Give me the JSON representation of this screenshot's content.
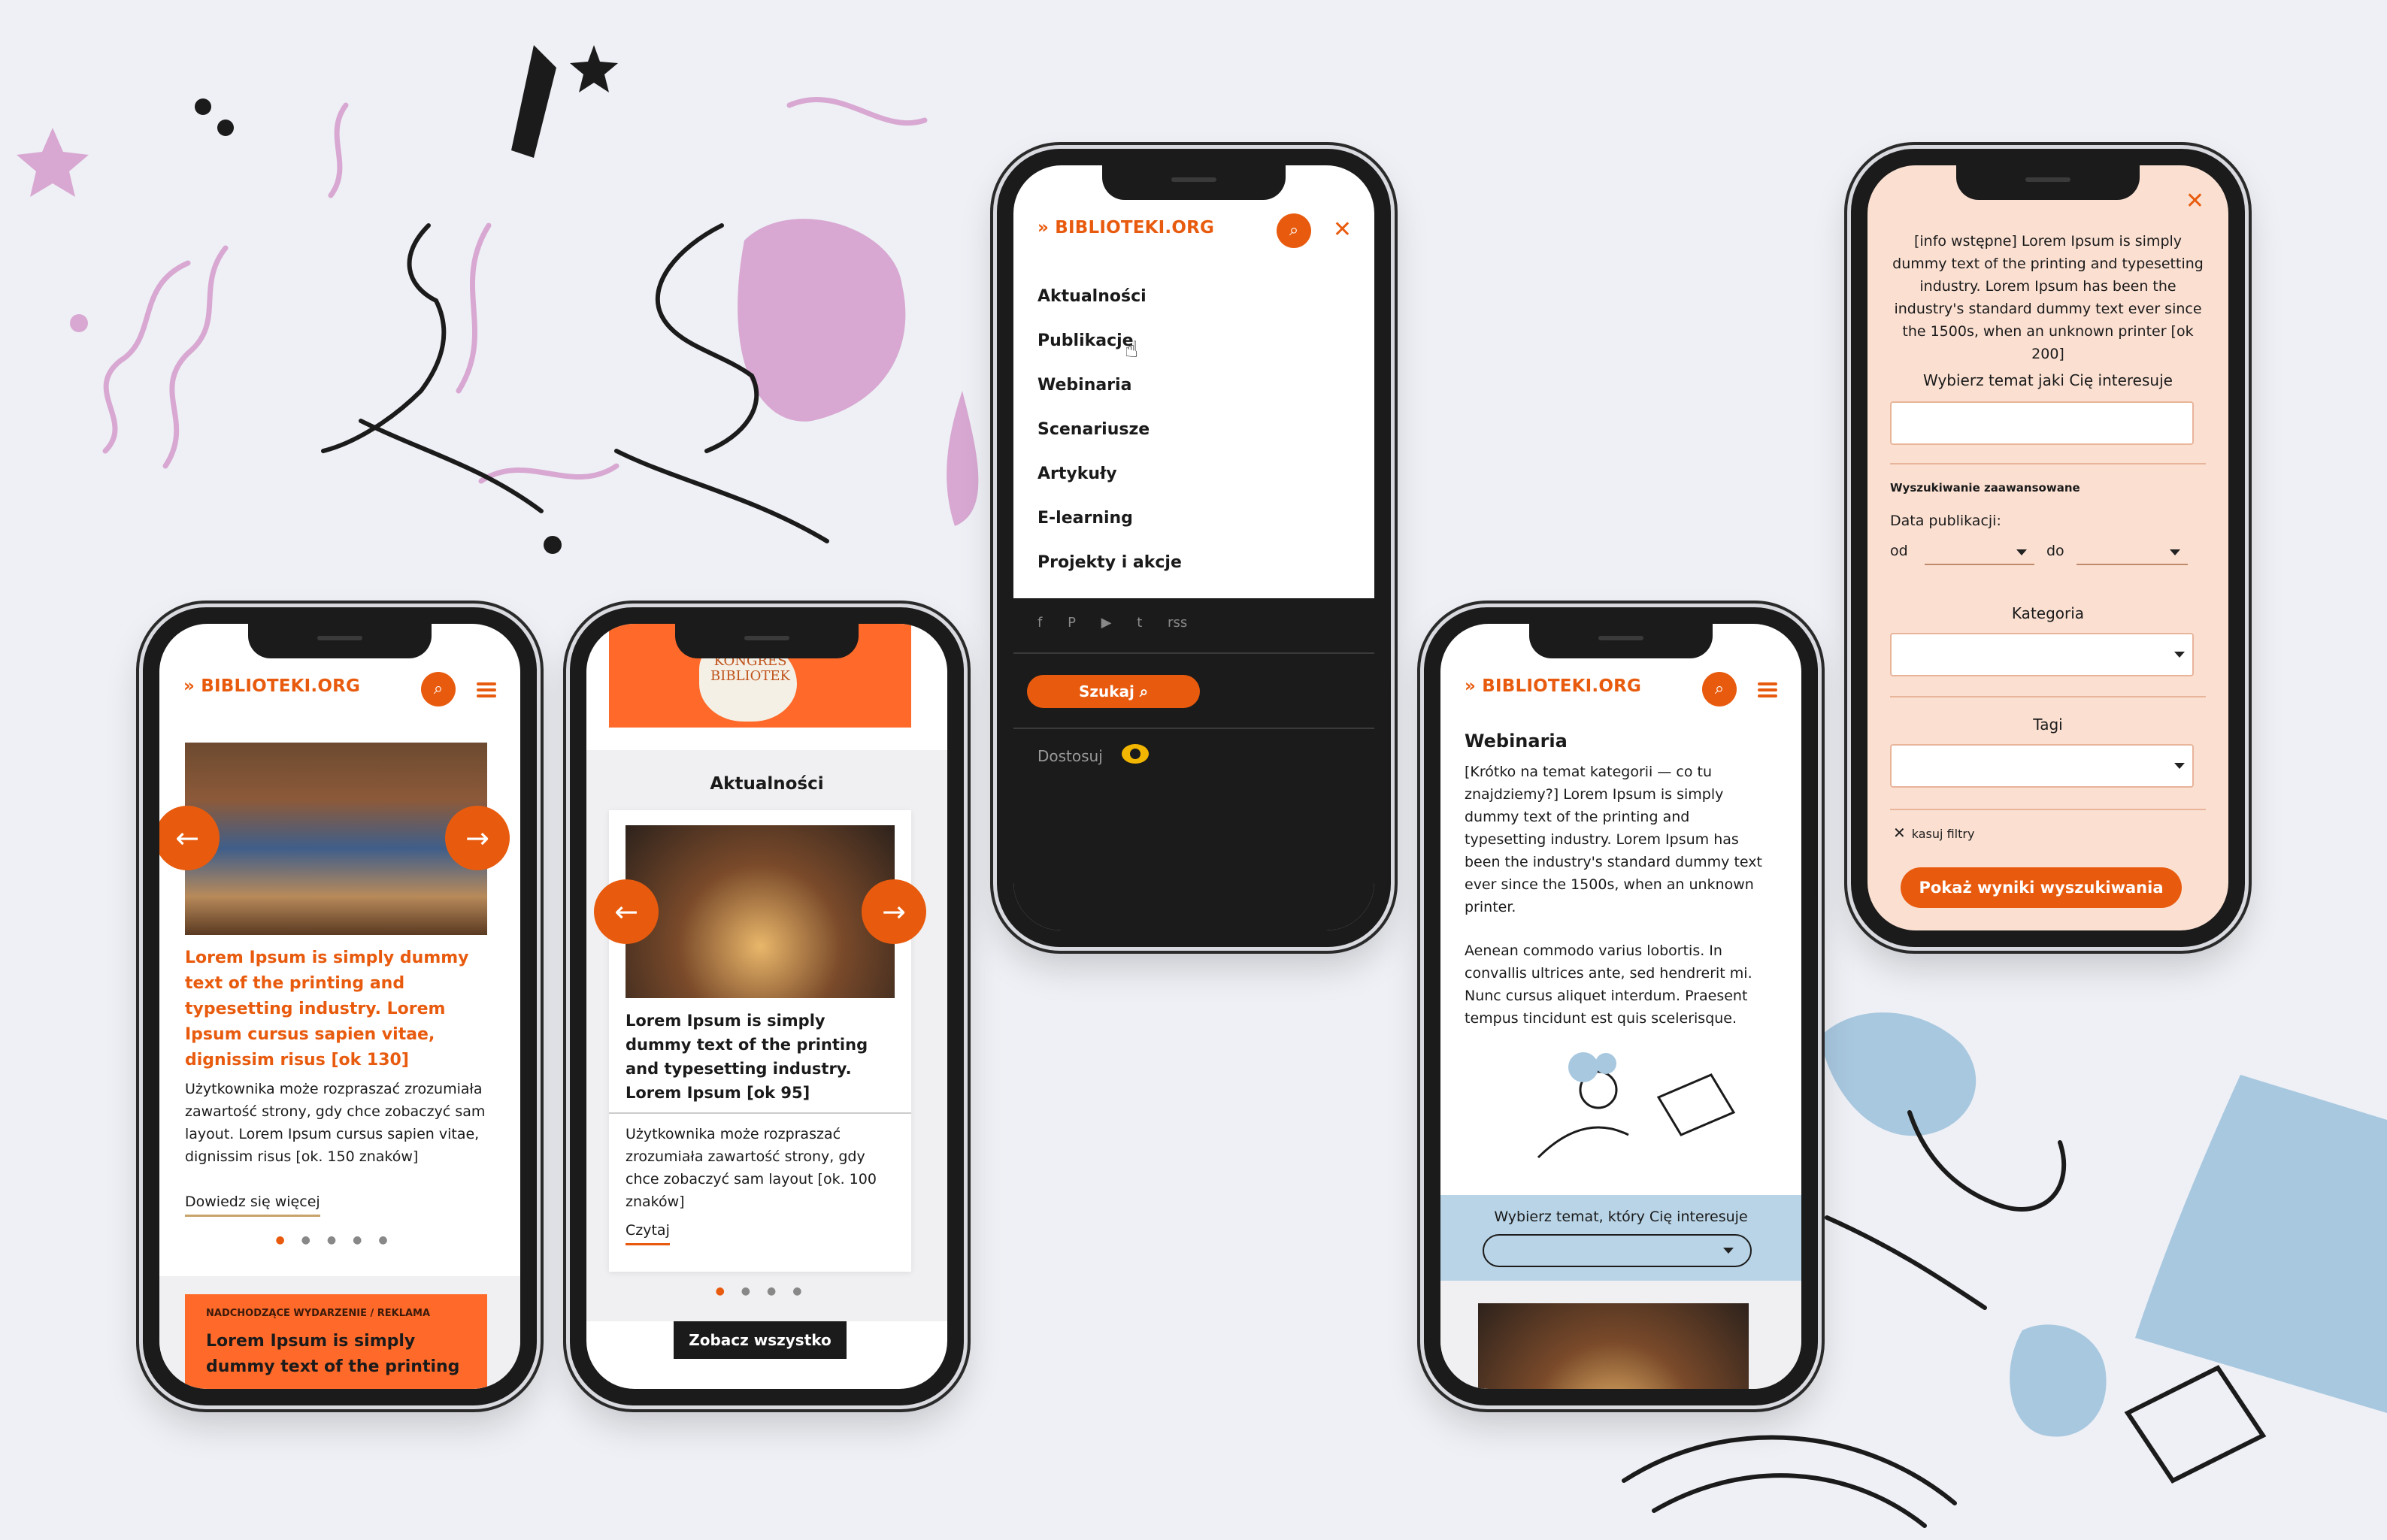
{
  "brand": {
    "logo": "» BIBLIOTEKI.ORG",
    "accent": "#e85b0e",
    "dark": "#1b1b1b",
    "filter_bg": "#fbe0d2",
    "topic_bg": "#b9d4e6"
  },
  "phone1": {
    "card_title": "Lorem Ipsum is simply dummy text of the printing and typesetting industry. Lorem Ipsum cursus sapien vitae, dignissim risus [ok 130]",
    "card_body": "Użytkownika może rozpraszać zrozumiała zawartość strony, gdy chce zobaczyć sam layout. Lorem Ipsum cursus sapien vitae, dignissim risus [ok. 150 znaków]",
    "card_link": "Dowiedz się więcej",
    "event_label": "NADCHODZĄCE WYDARZENIE / REKLAMA",
    "event_title": "Lorem Ipsum is simply dummy text of the printing",
    "prev": "←",
    "next": "→"
  },
  "phone2": {
    "banner_text": "KONGRES BIBLIOTEK",
    "section_title": "Aktualności",
    "card_title": "Lorem Ipsum is simply dummy text of the printing and typesetting industry. Lorem Ipsum [ok 95]",
    "card_body": "Użytkownika może rozpraszać zrozumiała zawartość strony, gdy chce zobaczyć sam layout [ok. 100 znaków]",
    "card_link": "Czytaj",
    "see_all": "Zobacz wszystko",
    "prev": "←",
    "next": "→"
  },
  "phone3": {
    "close": "✕",
    "menu": [
      "Aktualności",
      "Publikacje",
      "Webinaria",
      "Scenariusze",
      "Artykuły",
      "E-learning",
      "Projekty i akcje"
    ],
    "social": [
      "f",
      "P",
      "▶",
      "t",
      "rss"
    ],
    "search_button": "Szukaj",
    "adjust": "Dostosuj"
  },
  "phone4": {
    "title": "Webinaria",
    "intro": "[Krótko na temat kategorii — co tu znajdziemy?] Lorem Ipsum is simply dummy text of the printing and typesetting industry. Lorem Ipsum has been the industry's standard dummy text ever since the 1500s, when an unknown printer.",
    "para2": "Aenean commodo varius lobortis. In convallis ultrices ante, sed hendrerit mi. Nunc cursus aliquet interdum. Praesent tempus tincidunt est quis scelerisque.",
    "topic_label": "Wybierz temat, który Cię interesuje"
  },
  "phone5": {
    "close": "✕",
    "info": "[info wstępne] Lorem Ipsum is simply dummy text of the printing and typesetting industry. Lorem Ipsum has been the industry's standard dummy text ever since the 1500s, when an unknown printer [ok 200]",
    "topic_label": "Wybierz temat jaki Cię interesuje",
    "advanced": "Wyszukiwanie zaawansowane",
    "date_label": "Data publikacji:",
    "from": "od",
    "to": "do",
    "category": "Kategoria",
    "tags": "Tagi",
    "clear": "kasuj filtry",
    "submit": "Pokaż wyniki wyszukiwania"
  }
}
